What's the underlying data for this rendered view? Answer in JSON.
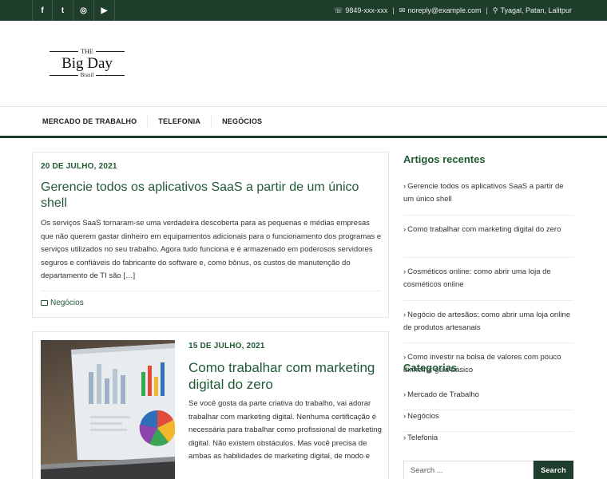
{
  "topbar": {
    "social": [
      {
        "icon": "facebook-icon",
        "glyph": "f"
      },
      {
        "icon": "twitter-icon",
        "glyph": "t"
      },
      {
        "icon": "instagram-icon",
        "glyph": "◎"
      },
      {
        "icon": "youtube-icon",
        "glyph": "▶"
      }
    ],
    "phone": "9849-xxx-xxx",
    "email": "noreply@example.com",
    "location": "Tyagal, Patan, Lalitpur"
  },
  "logo": {
    "the": "THE",
    "name": "Big Day",
    "sub": "Brasil"
  },
  "nav": [
    "MERCADO DE TRABALHO",
    "TELEFONIA",
    "NEGÓCIOS"
  ],
  "posts": [
    {
      "date": "20 DE JULHO, 2021",
      "title": "Gerencie todos os aplicativos SaaS a partir de um único shell",
      "excerpt": "Os serviços SaaS tornaram-se uma verdadeira descoberta para as pequenas e médias empresas que não querem gastar dinheiro em equipamentos adicionais para o funcionamento dos programas e serviços utilizados no seu trabalho. Agora tudo funciona e é armazenado em poderosos servidores seguros e confiáveis do fabricante do software e, como bônus, os custos de manutenção do departamento de TI são […]",
      "category": "Negócios"
    },
    {
      "date": "15 DE JULHO, 2021",
      "title": "Como trabalhar com marketing digital do zero",
      "excerpt": "Se você gosta da parte criativa do trabalho, vai adorar trabalhar com marketing digital. Nenhuma certificação é necessária para trabalhar como profissional de marketing digital. Não existem obstáculos. Mas você precisa de ambas as habilidades de marketing digital, de modo e"
    }
  ],
  "sidebar": {
    "recent_title": "Artigos recentes",
    "recent": [
      "Gerencie todos os aplicativos SaaS a partir de um único shell",
      "Como trabalhar com marketing digital do zero",
      "Cosméticos online: como abrir uma loja de cosméticos online",
      "Negócio de artesãos: como abrir uma loja online de produtos artesanais",
      "Como investir na bolsa de valores com pouco dinheiro: guia básico"
    ],
    "categories_title": "Categorias",
    "categories": [
      "Mercado de Trabalho",
      "Negócios",
      "Telefonia"
    ],
    "search_placeholder": "Search ...",
    "search_button": "Search"
  },
  "colors": {
    "brand_dark": "#1f3d2b",
    "brand_green": "#1f5a35"
  }
}
